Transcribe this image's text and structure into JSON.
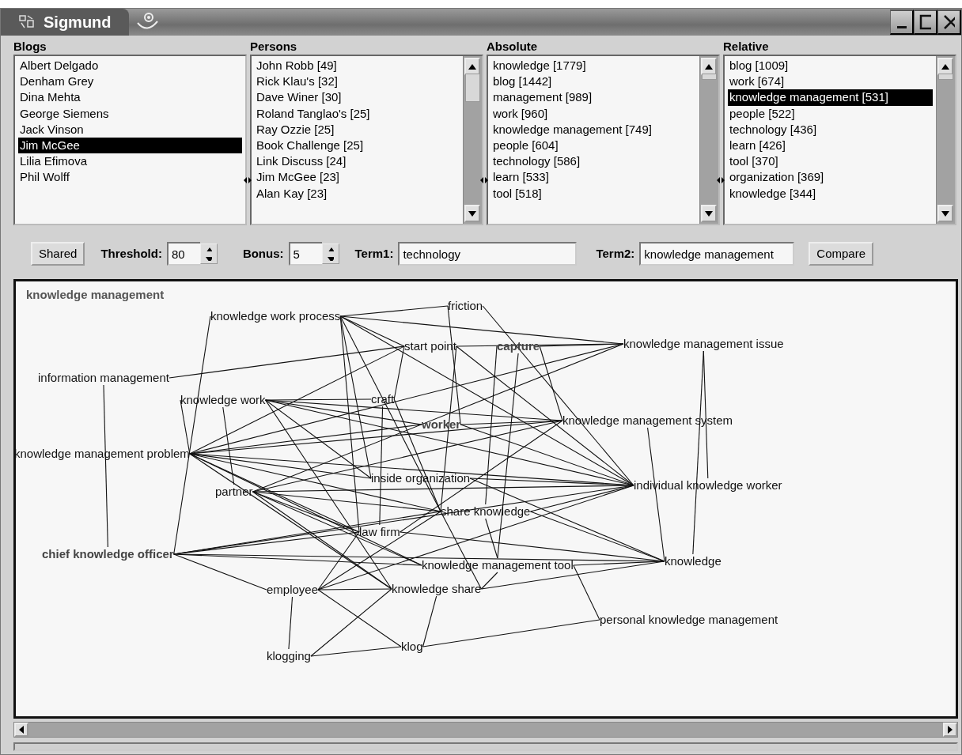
{
  "window": {
    "title": "Sigmund"
  },
  "lists": [
    {
      "title": "Blogs",
      "scrollbar": false,
      "items": [
        {
          "label": "Albert Delgado",
          "selected": false
        },
        {
          "label": "Denham Grey",
          "selected": false
        },
        {
          "label": "Dina Mehta",
          "selected": false
        },
        {
          "label": "George Siemens",
          "selected": false
        },
        {
          "label": "Jack Vinson",
          "selected": false
        },
        {
          "label": "Jim McGee",
          "selected": true
        },
        {
          "label": "Lilia Efimova",
          "selected": false
        },
        {
          "label": "Phil Wolff",
          "selected": false
        }
      ]
    },
    {
      "title": "Persons",
      "scrollbar": true,
      "items": [
        {
          "label": "John Robb [49]",
          "selected": false
        },
        {
          "label": "Rick Klau's [32]",
          "selected": false
        },
        {
          "label": "Dave Winer [30]",
          "selected": false
        },
        {
          "label": "Roland Tanglao's [25]",
          "selected": false
        },
        {
          "label": "Ray Ozzie [25]",
          "selected": false
        },
        {
          "label": "Book Challenge [25]",
          "selected": false
        },
        {
          "label": "Link Discuss [24]",
          "selected": false
        },
        {
          "label": "Jim McGee [23]",
          "selected": false
        },
        {
          "label": "Alan Kay [23]",
          "selected": false
        }
      ]
    },
    {
      "title": "Absolute",
      "scrollbar": true,
      "items": [
        {
          "label": "knowledge [1779]",
          "selected": false
        },
        {
          "label": "blog [1442]",
          "selected": false
        },
        {
          "label": "management [989]",
          "selected": false
        },
        {
          "label": "work [960]",
          "selected": false
        },
        {
          "label": "knowledge management [749]",
          "selected": false
        },
        {
          "label": "people [604]",
          "selected": false
        },
        {
          "label": "technology [586]",
          "selected": false
        },
        {
          "label": "learn [533]",
          "selected": false
        },
        {
          "label": "tool [518]",
          "selected": false
        }
      ]
    },
    {
      "title": "Relative",
      "scrollbar": true,
      "items": [
        {
          "label": "blog [1009]",
          "selected": false
        },
        {
          "label": "work [674]",
          "selected": false
        },
        {
          "label": "knowledge management [531]",
          "selected": true
        },
        {
          "label": "people [522]",
          "selected": false
        },
        {
          "label": "technology [436]",
          "selected": false
        },
        {
          "label": "learn [426]",
          "selected": false
        },
        {
          "label": "tool [370]",
          "selected": false
        },
        {
          "label": "organization [369]",
          "selected": false
        },
        {
          "label": "knowledge [344]",
          "selected": false
        }
      ]
    }
  ],
  "toolbar": {
    "shared_button": {
      "label": "Shared"
    },
    "threshold": {
      "label": "Threshold:",
      "value": "80"
    },
    "bonus": {
      "label": "Bonus:",
      "value": "5"
    },
    "term1": {
      "label": "Term1:",
      "value": "technology"
    },
    "term2": {
      "label": "Term2:",
      "value": "knowledge management"
    },
    "compare_button": {
      "label": "Compare"
    }
  },
  "graph": {
    "title": "knowledge management",
    "nodes": [
      {
        "label": "knowledge work process",
        "emphasized": false
      },
      {
        "label": "friction",
        "emphasized": false
      },
      {
        "label": "start point",
        "emphasized": false
      },
      {
        "label": "capture",
        "emphasized": true
      },
      {
        "label": "knowledge management issue",
        "emphasized": false
      },
      {
        "label": "information management",
        "emphasized": false
      },
      {
        "label": "knowledge work",
        "emphasized": false
      },
      {
        "label": "craft",
        "emphasized": false
      },
      {
        "label": "worker",
        "emphasized": true
      },
      {
        "label": "knowledge management system",
        "emphasized": false
      },
      {
        "label": "knowledge management problem",
        "emphasized": false
      },
      {
        "label": "inside organization",
        "emphasized": false
      },
      {
        "label": "individual knowledge worker",
        "emphasized": false
      },
      {
        "label": "partner",
        "emphasized": false
      },
      {
        "label": "share knowledge",
        "emphasized": false
      },
      {
        "label": "law firm",
        "emphasized": false
      },
      {
        "label": "chief knowledge officer",
        "emphasized": true
      },
      {
        "label": "knowledge management tool",
        "emphasized": false
      },
      {
        "label": "knowledge",
        "emphasized": false
      },
      {
        "label": "employee",
        "emphasized": false
      },
      {
        "label": "knowledge share",
        "emphasized": false
      },
      {
        "label": "personal knowledge management",
        "emphasized": false
      },
      {
        "label": "klogging",
        "emphasized": false
      },
      {
        "label": "klog",
        "emphasized": false
      }
    ]
  }
}
